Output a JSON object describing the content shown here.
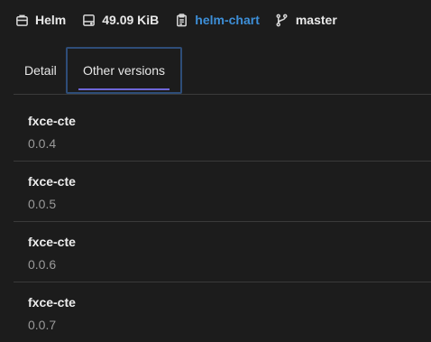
{
  "package": {
    "type": {
      "icon": "package-icon",
      "label": "Helm"
    },
    "size": {
      "icon": "disk-icon",
      "label": "49.09 KiB"
    },
    "repository": {
      "icon": "clipboard-icon",
      "label": "helm-chart"
    },
    "branch": {
      "icon": "git-branch-icon",
      "label": "master"
    }
  },
  "tabs": [
    {
      "label": "Detail",
      "active": false
    },
    {
      "label": "Other versions",
      "active": true
    }
  ],
  "versions": [
    {
      "name": "fxce-cte",
      "version": "0.0.4"
    },
    {
      "name": "fxce-cte",
      "version": "0.0.5"
    },
    {
      "name": "fxce-cte",
      "version": "0.0.6"
    },
    {
      "name": "fxce-cte",
      "version": "0.0.7"
    }
  ],
  "colors": {
    "background": "#1c1c1c",
    "link": "#3d8fd8",
    "tab_focus_border": "#2e4d78",
    "tab_underline": "#6e66d8",
    "divider": "#3a3a3a",
    "muted_text": "#9a9a9a"
  }
}
